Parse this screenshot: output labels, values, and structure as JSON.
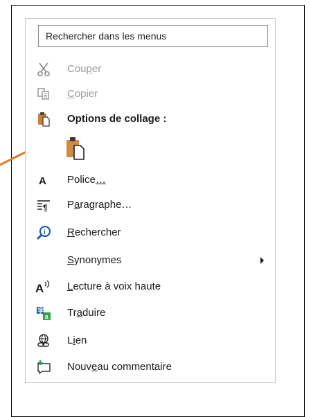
{
  "search": {
    "placeholder": "Rechercher dans les menus"
  },
  "menu": {
    "items": [
      {
        "before": "Cou",
        "mn": "p",
        "after": "er",
        "icon": "scissors-icon"
      },
      {
        "before": "",
        "mn": "C",
        "after": "opier",
        "icon": "copy-icon"
      },
      {
        "label": "Options de collage :",
        "icon": "paste-options-icon"
      },
      {
        "before": "Police",
        "mn": "…",
        "after": "",
        "icon": "font-icon"
      },
      {
        "before": "P",
        "mn": "a",
        "after": "ragraphe…",
        "icon": "paragraph-icon"
      },
      {
        "before": "",
        "mn": "R",
        "after": "echercher",
        "icon": "search-icon"
      },
      {
        "before": "",
        "mn": "S",
        "after": "ynonymes",
        "icon": ""
      },
      {
        "before": "",
        "mn": "L",
        "after": "ecture à voix haute",
        "icon": "read-aloud-icon"
      },
      {
        "before": "Tr",
        "mn": "a",
        "after": "duire",
        "icon": "translate-icon"
      },
      {
        "before": "L",
        "mn": "i",
        "after": "en",
        "icon": "link-icon"
      },
      {
        "before": "Nouv",
        "mn": "e",
        "after": "au commentaire",
        "icon": "new-comment-icon"
      }
    ]
  },
  "paste_button": {
    "icon": "paste-keep-source-icon"
  },
  "colors": {
    "accent": "#e07b24",
    "icon_blue": "#1f5fa8",
    "disabled": "#9b9b9b"
  }
}
